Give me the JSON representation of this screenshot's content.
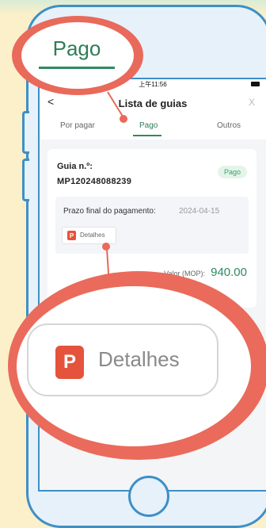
{
  "status_bar": {
    "time": "上午11:56"
  },
  "nav": {
    "back": "<",
    "title": "Lista de guias",
    "close": "X"
  },
  "tabs": [
    {
      "label": "Por pagar"
    },
    {
      "label": "Pago",
      "active": true
    },
    {
      "label": "Outros"
    }
  ],
  "card": {
    "guide_label": "Guia n.º:",
    "guide_number": "MP120248088239",
    "status": "Pago",
    "deadline_label": "Prazo final do pagamento:",
    "deadline_date": "2024-04-15",
    "details_button": "Detalhes",
    "amount_label": "Valor (MOP):",
    "amount_value": "940.00"
  },
  "callouts": {
    "top_label": "Pago",
    "bottom_label": "Detalhes",
    "doc_icon_letter": "P"
  },
  "colors": {
    "accent_green": "#2e8a61",
    "callout_red": "#e9695a",
    "phone_blue": "#3e8fc6",
    "background": "#fbf0c9"
  },
  "icons": [
    "back-icon",
    "close-icon",
    "document-icon"
  ]
}
